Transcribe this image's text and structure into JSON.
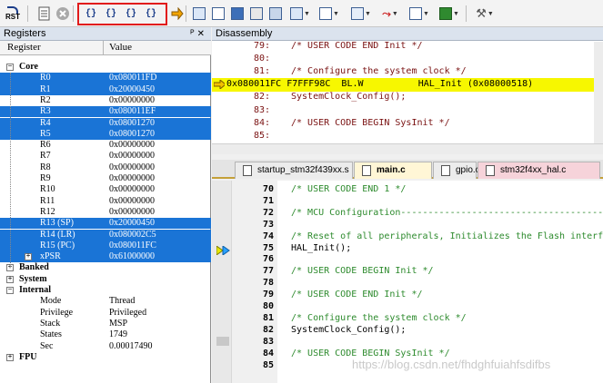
{
  "toolbar": {
    "rst_label": "RST",
    "step_into": "{}",
    "step_over": "{}",
    "step_out": "{}",
    "run_to_cursor": "{}"
  },
  "registers": {
    "panel_title": "Registers",
    "col_register": "Register",
    "col_value": "Value",
    "core_label": "Core",
    "rows": [
      {
        "name": "R0",
        "value": "0x080011FD",
        "selected": true
      },
      {
        "name": "R1",
        "value": "0x20000450",
        "selected": true
      },
      {
        "name": "R2",
        "value": "0x00000000",
        "selected": false
      },
      {
        "name": "R3",
        "value": "0x080011EF",
        "selected": true
      },
      {
        "name": "R4",
        "value": "0x08001270",
        "selected": true
      },
      {
        "name": "R5",
        "value": "0x08001270",
        "selected": true
      },
      {
        "name": "R6",
        "value": "0x00000000",
        "selected": false
      },
      {
        "name": "R7",
        "value": "0x00000000",
        "selected": false
      },
      {
        "name": "R8",
        "value": "0x00000000",
        "selected": false
      },
      {
        "name": "R9",
        "value": "0x00000000",
        "selected": false
      },
      {
        "name": "R10",
        "value": "0x00000000",
        "selected": false
      },
      {
        "name": "R11",
        "value": "0x00000000",
        "selected": false
      },
      {
        "name": "R12",
        "value": "0x00000000",
        "selected": false
      },
      {
        "name": "R13 (SP)",
        "value": "0x20000450",
        "selected": true
      },
      {
        "name": "R14 (LR)",
        "value": "0x080002C5",
        "selected": true
      },
      {
        "name": "R15 (PC)",
        "value": "0x080011FC",
        "selected": true
      },
      {
        "name": "xPSR",
        "value": "0x61000000",
        "selected": true
      }
    ],
    "banked_label": "Banked",
    "system_label": "System",
    "internal_label": "Internal",
    "internal_rows": [
      {
        "name": "Mode",
        "value": "Thread"
      },
      {
        "name": "Privilege",
        "value": "Privileged"
      },
      {
        "name": "Stack",
        "value": "MSP"
      },
      {
        "name": "States",
        "value": "1749"
      },
      {
        "name": "Sec",
        "value": "0.00017490"
      }
    ],
    "fpu_label": "FPU"
  },
  "disassembly": {
    "panel_title": "Disassembly",
    "lines": [
      {
        "ln": "79:",
        "text": "/* USER CODE END Init */",
        "current": false
      },
      {
        "ln": "80:",
        "text": "",
        "current": false
      },
      {
        "ln": "81:",
        "text": "/* Configure the system clock */",
        "current": false
      },
      {
        "ln": "",
        "text": "0x080011FC F7FFF98C  BL.W          HAL_Init (0x08000518)",
        "current": true
      },
      {
        "ln": "82:",
        "text": "SystemClock_Config();",
        "current": false
      },
      {
        "ln": "83:",
        "text": "",
        "current": false
      },
      {
        "ln": "84:",
        "text": "/* USER CODE BEGIN SysInit */",
        "current": false
      },
      {
        "ln": "85:",
        "text": "",
        "current": false
      }
    ]
  },
  "tabs": [
    {
      "label": "startup_stm32f439xx.s",
      "active": false
    },
    {
      "label": "main.c",
      "active": true
    },
    {
      "label": "gpio.c",
      "active": false
    },
    {
      "label": "stm32f4xx_hal.c",
      "active": false
    }
  ],
  "editor": {
    "lines": [
      {
        "ln": "70",
        "text": "/* USER CODE END 1 */",
        "kind": "comment"
      },
      {
        "ln": "71",
        "text": "",
        "kind": "code"
      },
      {
        "ln": "72",
        "text": "/* MCU Configuration--------------------------------------------------------*/",
        "kind": "comment"
      },
      {
        "ln": "73",
        "text": "",
        "kind": "code"
      },
      {
        "ln": "74",
        "text": "/* Reset of all peripherals, Initializes the Flash interface and the Systick. */",
        "kind": "comment"
      },
      {
        "ln": "75",
        "text": "HAL_Init();",
        "kind": "code"
      },
      {
        "ln": "76",
        "text": "",
        "kind": "code"
      },
      {
        "ln": "77",
        "text": "/* USER CODE BEGIN Init */",
        "kind": "comment"
      },
      {
        "ln": "78",
        "text": "",
        "kind": "code"
      },
      {
        "ln": "79",
        "text": "/* USER CODE END Init */",
        "kind": "comment"
      },
      {
        "ln": "80",
        "text": "",
        "kind": "code"
      },
      {
        "ln": "81",
        "text": "/* Configure the system clock */",
        "kind": "comment"
      },
      {
        "ln": "82",
        "text": "SystemClock_Config();",
        "kind": "code"
      },
      {
        "ln": "83",
        "text": "",
        "kind": "code"
      },
      {
        "ln": "84",
        "text": "/* USER CODE BEGIN SysInit */",
        "kind": "comment"
      },
      {
        "ln": "85",
        "text": "",
        "kind": "code"
      }
    ]
  },
  "watermark": "https://blog.csdn.net/fhdghfuiahfsdifbs"
}
